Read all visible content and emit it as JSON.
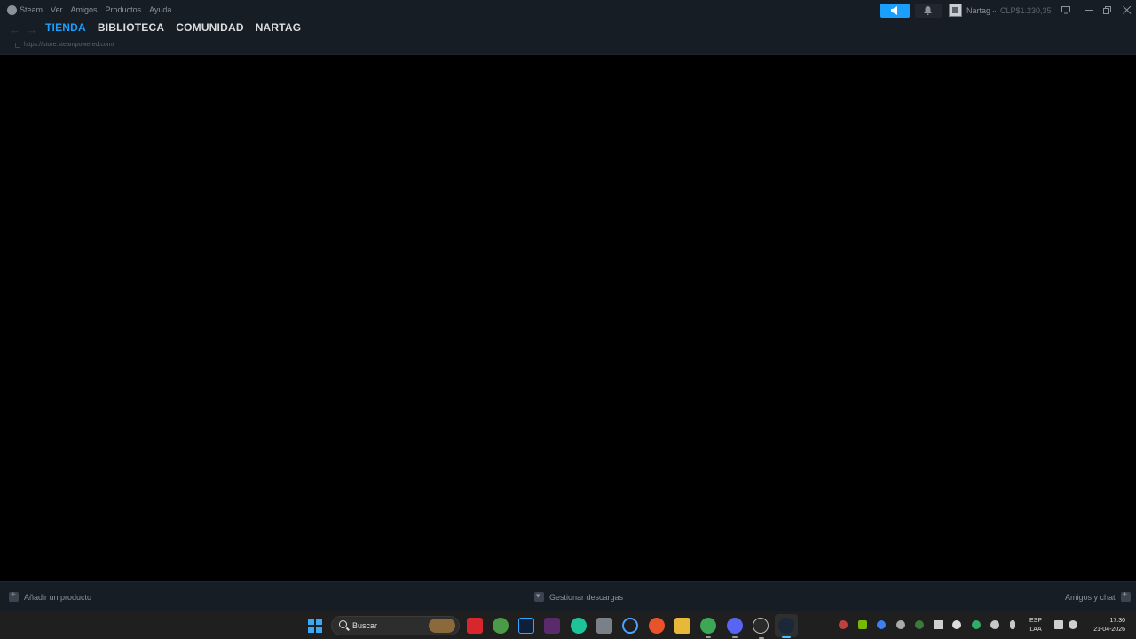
{
  "menubar": {
    "items": [
      "Steam",
      "Ver",
      "Amigos",
      "Productos",
      "Ayuda"
    ]
  },
  "account": {
    "name": "Nartag",
    "balance": "CLP$1.230,35"
  },
  "nav": {
    "tabs": [
      "TIENDA",
      "BIBLIOTECA",
      "COMUNIDAD",
      "NARTAG"
    ],
    "active_tab": "TIENDA",
    "url": "https://store.steampowered.com/"
  },
  "bottom_bar": {
    "add_product": "Añadir un producto",
    "downloads": "Gestionar descargas",
    "friends_chat": "Amigos y chat"
  },
  "taskbar": {
    "search_label": "Buscar",
    "lang_line1": "ESP",
    "lang_line2": "LAA",
    "time": "17:30",
    "date": "21-04-2026"
  },
  "colors": {
    "accent": "#1a9fff",
    "bar_bg": "#171d25",
    "content_bg": "#000000"
  }
}
